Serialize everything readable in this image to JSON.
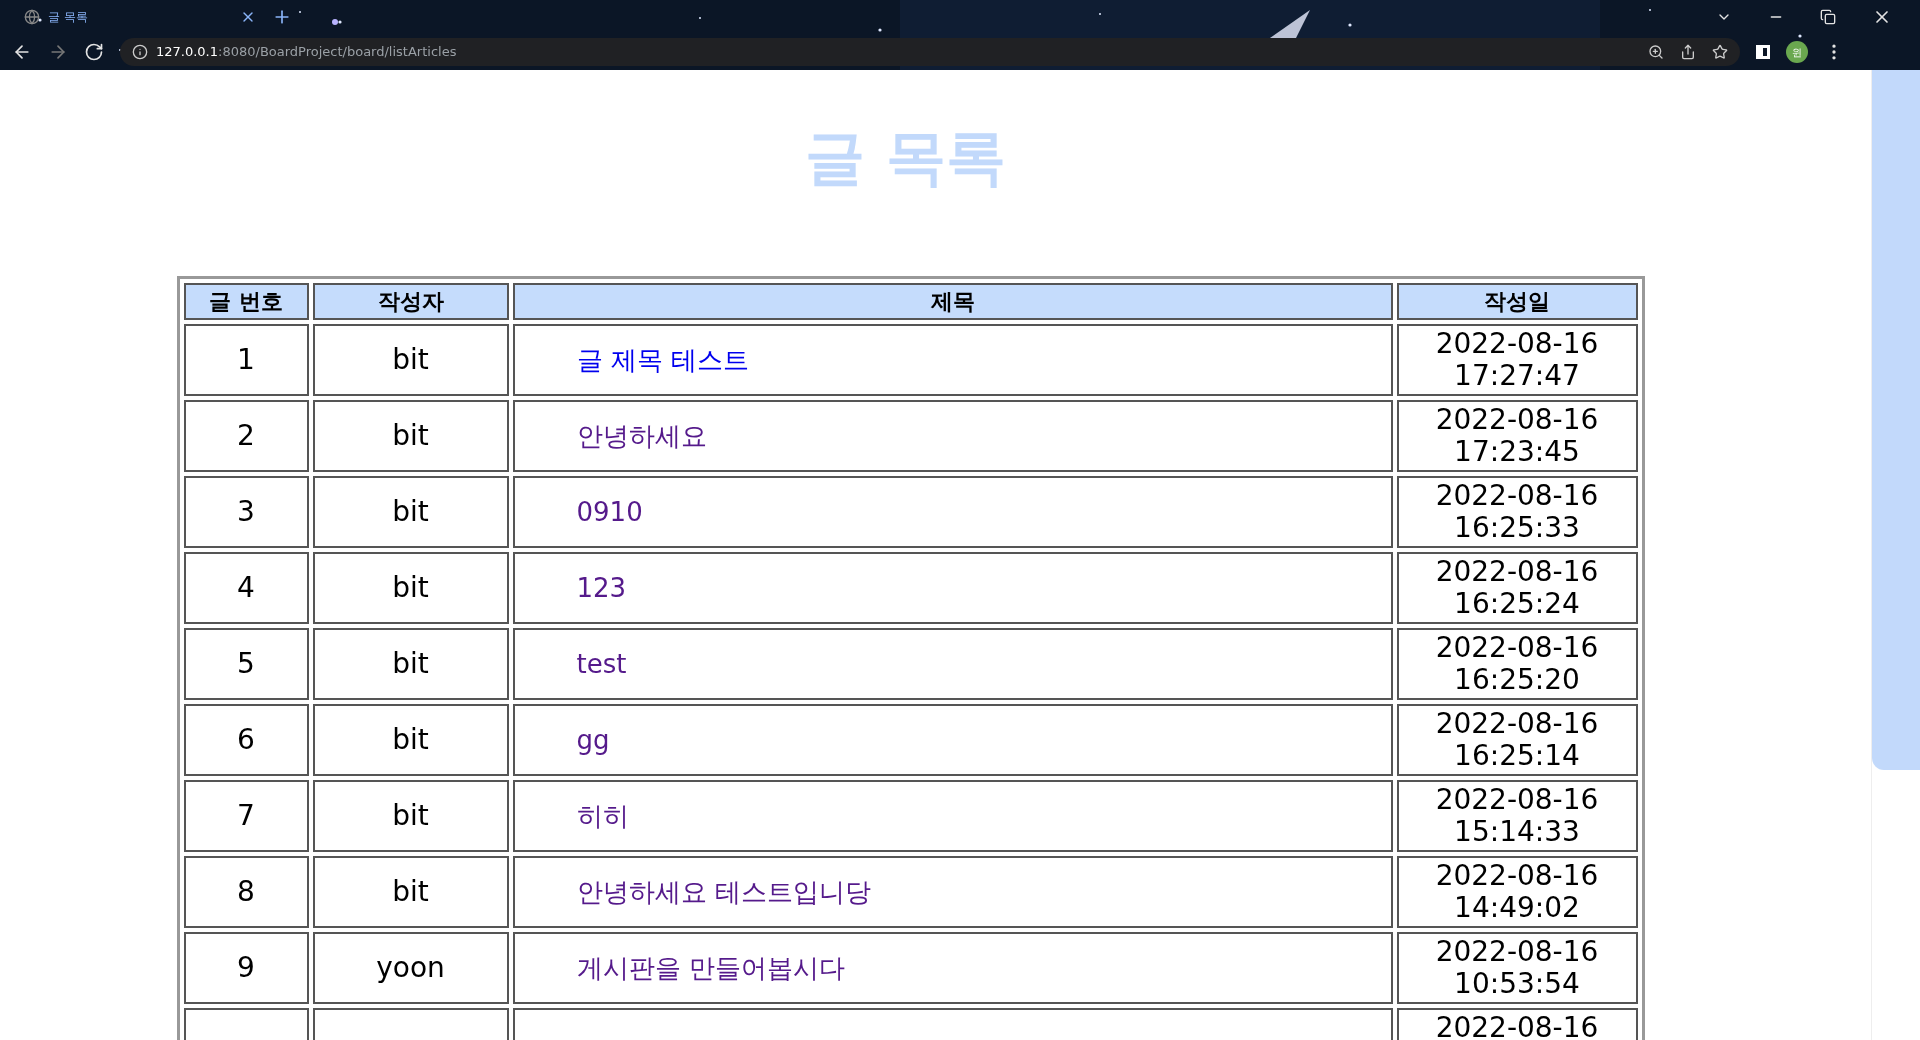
{
  "browser": {
    "tab": {
      "title": "글 목록",
      "selected": true
    },
    "address": {
      "host": "127.0.0.1",
      "path": ":8080/BoardProject/board/listArticles"
    },
    "profile": "윈"
  },
  "page": {
    "title": "글 목록"
  },
  "table": {
    "columns": [
      "글 번호",
      "작성자",
      "제목",
      "작성일"
    ],
    "rows": [
      {
        "no": "1",
        "writer": "bit",
        "title": "글 제목 테스트",
        "visited": false,
        "date": "2022-08-16",
        "time": "17:27:47"
      },
      {
        "no": "2",
        "writer": "bit",
        "title": "안녕하세요",
        "visited": true,
        "date": "2022-08-16",
        "time": "17:23:45"
      },
      {
        "no": "3",
        "writer": "bit",
        "title": "0910",
        "visited": true,
        "date": "2022-08-16",
        "time": "16:25:33"
      },
      {
        "no": "4",
        "writer": "bit",
        "title": "123",
        "visited": true,
        "date": "2022-08-16",
        "time": "16:25:24"
      },
      {
        "no": "5",
        "writer": "bit",
        "title": "test",
        "visited": true,
        "date": "2022-08-16",
        "time": "16:25:20"
      },
      {
        "no": "6",
        "writer": "bit",
        "title": "gg",
        "visited": true,
        "date": "2022-08-16",
        "time": "16:25:14"
      },
      {
        "no": "7",
        "writer": "bit",
        "title": "히히",
        "visited": true,
        "date": "2022-08-16",
        "time": "15:14:33"
      },
      {
        "no": "8",
        "writer": "bit",
        "title": "안녕하세요 테스트입니당",
        "visited": true,
        "date": "2022-08-16",
        "time": "14:49:02"
      },
      {
        "no": "9",
        "writer": "yoon",
        "title": "게시판을 만들어봅시다",
        "visited": true,
        "date": "2022-08-16",
        "time": "10:53:54"
      },
      {
        "date": "2022-08-16"
      }
    ]
  }
}
